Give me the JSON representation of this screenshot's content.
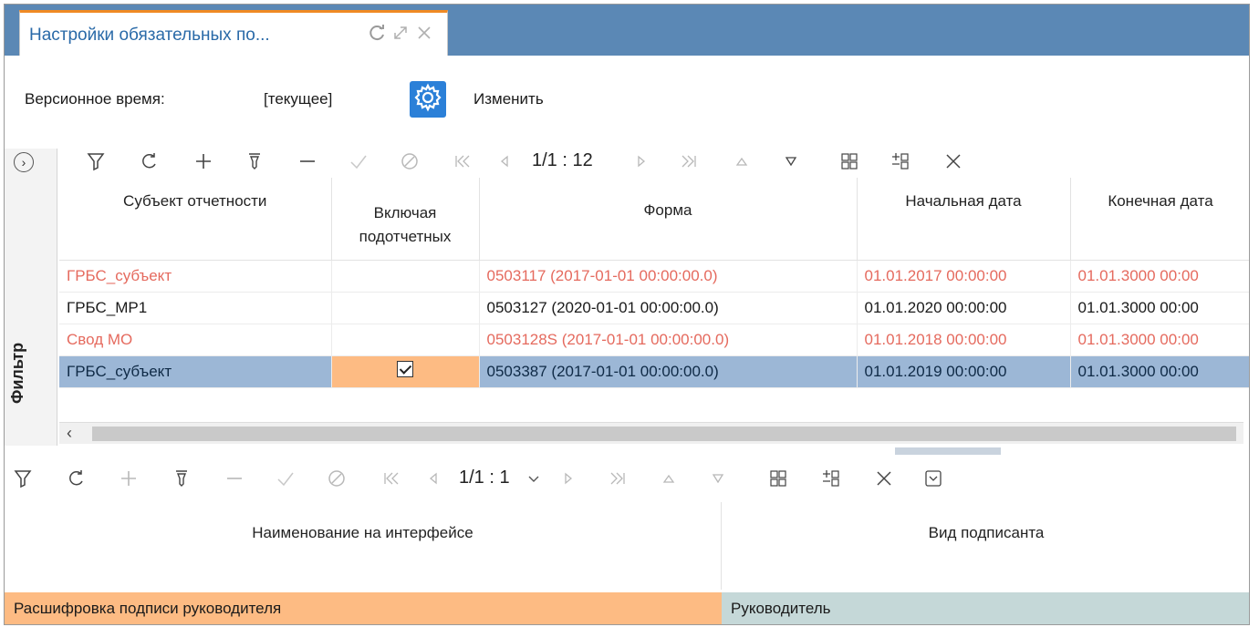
{
  "tab": {
    "title": "Настройки обязательных по..."
  },
  "version": {
    "label": "Версионное время:",
    "value": "[текущее]",
    "edit_label": "Изменить"
  },
  "top_toolbar": {
    "pager": "1/1 : 12"
  },
  "bottom_toolbar": {
    "pager": "1/1 : 1"
  },
  "side": {
    "label": "Фильтр"
  },
  "top_grid": {
    "columns": [
      "Субъект отчетности",
      "Включая подотчетных",
      "Форма",
      "Начальная дата",
      "Конечная дата"
    ],
    "rows": [
      {
        "subject": "ГРБС_субъект",
        "incl": "",
        "form": "0503117 (2017-01-01 00:00:00.0)",
        "start": "01.01.2017 00:00:00",
        "end": "01.01.3000 00:00"
      },
      {
        "subject": "ГРБС_МР1",
        "incl": "",
        "form": "0503127 (2020-01-01 00:00:00.0)",
        "start": "01.01.2020 00:00:00",
        "end": "01.01.3000 00:00"
      },
      {
        "subject": "Свод МО",
        "incl": "",
        "form": "0503128S (2017-01-01 00:00:00.0)",
        "start": "01.01.2018 00:00:00",
        "end": "01.01.3000 00:00"
      },
      {
        "subject": "ГРБС_субъект",
        "incl": "checked",
        "form": "0503387 (2017-01-01 00:00:00.0)",
        "start": "01.01.2019 00:00:00",
        "end": "01.01.3000 00:00"
      }
    ]
  },
  "bottom_grid": {
    "columns": [
      "Наименование на интерфейсе",
      "Вид подписанта"
    ],
    "rows": [
      {
        "name": "Расшифровка подписи руководителя",
        "type": "Руководитель"
      }
    ]
  },
  "colors": {
    "tabbar": "#5b88b5",
    "accent_orange": "#f08a24",
    "selection": "#9cb7d6",
    "selection_orange": "#fdbb83",
    "red_text": "#e56a5e",
    "gear_button": "#2b80d8"
  }
}
